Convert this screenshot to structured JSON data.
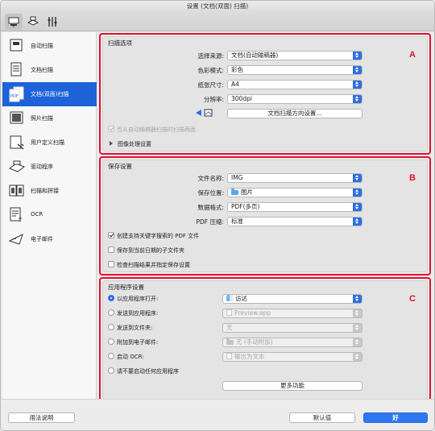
{
  "window": {
    "title": "设置 (文档(双面) 扫描)"
  },
  "sidebar": {
    "items": [
      {
        "label": "自动扫描"
      },
      {
        "label": "文档扫描"
      },
      {
        "label": "文档(双面)扫描"
      },
      {
        "label": "照片扫描"
      },
      {
        "label": "用户定义扫描"
      },
      {
        "label": "驱动程序"
      },
      {
        "label": "扫描和拼接"
      },
      {
        "label": "OCR"
      },
      {
        "label": "电子邮件"
      }
    ]
  },
  "scan_options": {
    "title": "扫描选项",
    "marker": "A",
    "source_label": "选择来源:",
    "source_value": "文档(自动输稿器)",
    "color_mode_label": "色彩模式:",
    "color_mode_value": "彩色",
    "paper_size_label": "纸张尺寸:",
    "paper_size_value": "A4",
    "resolution_label": "分辨率:",
    "resolution_value": "300dpi",
    "orientation_button": "文档扫描方向设置...",
    "duplex_checkbox": "当从自动输稿器扫描时扫描两面",
    "image_processing": "图像处理设置"
  },
  "save_settings": {
    "title": "保存设置",
    "marker": "B",
    "file_name_label": "文件名称:",
    "file_name_value": "IMG",
    "save_in_label": "保存位置:",
    "save_in_value": "图片",
    "data_format_label": "数据格式:",
    "data_format_value": "PDF(多页)",
    "pdf_compression_label": "PDF 压缩:",
    "pdf_compression_value": "标准",
    "check_keyword_pdf": "创建支持关键字搜索的 PDF 文件",
    "check_date_subfolder": "保存到当前日期的子文件夹",
    "check_results": "检查扫描结果并指定保存设置"
  },
  "app_settings": {
    "title": "应用程序设置",
    "marker": "C",
    "radio_open_with": "以应用程序打开:",
    "open_with_value": "访达",
    "radio_send_app": "发送到应用程序:",
    "send_app_value": "Preview.app",
    "radio_send_folder": "发送到文件夹:",
    "send_folder_value": "无",
    "radio_attach_email": "附加到电子邮件:",
    "attach_email_value": "无 (手动附加)",
    "radio_start_ocr": "启动 OCR:",
    "start_ocr_value": "输出为文本",
    "radio_no_app": "请不要启动任何应用程序",
    "more_functions": "更多功能"
  },
  "footer": {
    "help": "用法说明",
    "defaults": "默认值",
    "ok": "好"
  }
}
